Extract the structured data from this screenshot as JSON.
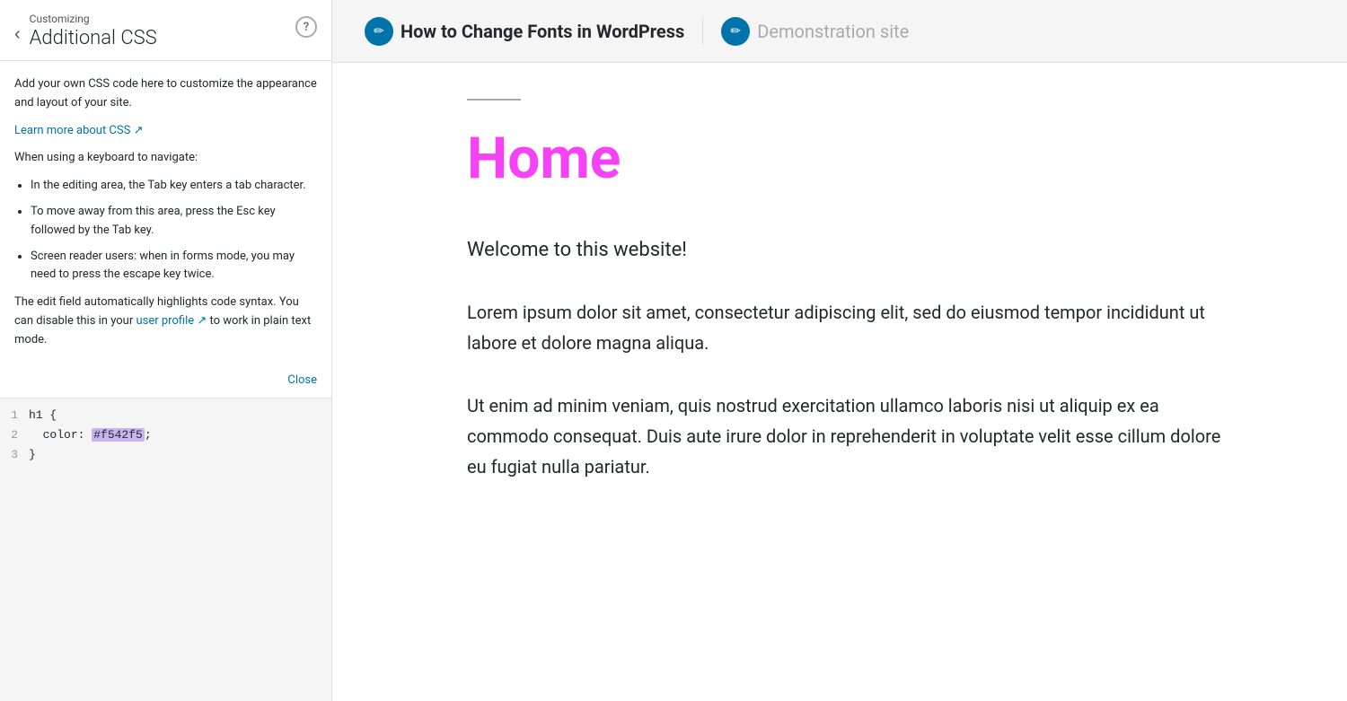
{
  "left_panel": {
    "back_button_label": "‹",
    "customizing_label": "Customizing",
    "title": "Additional CSS",
    "help_icon_label": "?",
    "info_text_1": "Add your own CSS code here to customize the appearance and layout of your site.",
    "learn_more_link": "Learn more about CSS",
    "learn_more_icon": "↗",
    "keyboard_label": "When using a keyboard to navigate:",
    "bullet_1": "In the editing area, the Tab key enters a tab character.",
    "bullet_2": "To move away from this area, press the Esc key followed by the Tab key.",
    "bullet_3": "Screen reader users: when in forms mode, you may need to press the escape key twice.",
    "info_text_2": "The edit field automatically highlights code syntax. You can disable this in your",
    "user_profile_link": "user profile",
    "user_profile_icon": "↗",
    "info_text_2_end": " to work in plain text mode.",
    "close_label": "Close",
    "code": {
      "lines": [
        {
          "number": "1",
          "content": "h1 {"
        },
        {
          "number": "2",
          "content": "  color: #f542f5;"
        },
        {
          "number": "3",
          "content": "}"
        }
      ]
    }
  },
  "preview_toolbar": {
    "link1_text": "How to Change Fonts in WordPress",
    "link2_text": "Demonstration site"
  },
  "preview_content": {
    "heading": "Home",
    "welcome": "Welcome to this website!",
    "paragraph1": "Lorem ipsum dolor sit amet, consectetur adipiscing elit, sed do eiusmod tempor incididunt ut labore et dolore magna aliqua.",
    "paragraph2": "Ut enim ad minim veniam, quis nostrud exercitation ullamco laboris nisi ut aliquip ex ea commodo consequat. Duis aute irure dolor in reprehenderit in voluptate velit esse cillum dolore eu fugiat nulla pariatur."
  },
  "colors": {
    "heading_color": "#f542f5",
    "link_color": "#0073aa",
    "icon_bg": "#0073aa"
  }
}
